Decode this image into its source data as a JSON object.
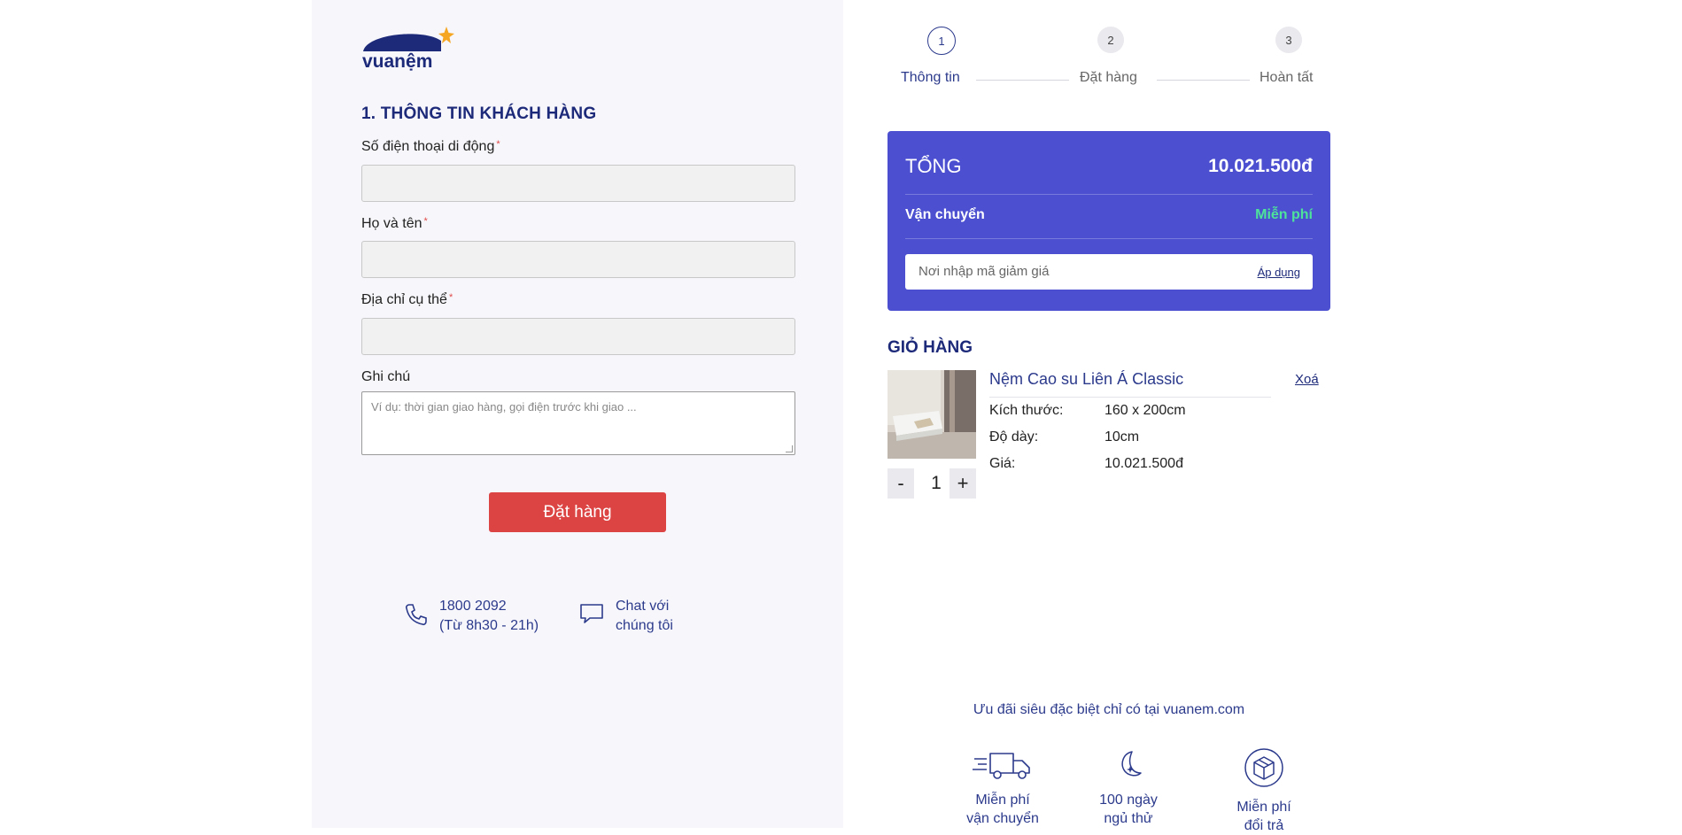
{
  "brand": {
    "logo_text": "vuanệm",
    "accent": "#1d2a7a",
    "star_color": "#f5a623"
  },
  "form": {
    "section_title": "1. THÔNG TIN KHÁCH HÀNG",
    "phone_label": "Số điện thoại di động",
    "name_label": "Họ và tên",
    "address_label": "Địa chỉ cụ thể",
    "note_label": "Ghi chú",
    "required_mark": "*",
    "phone_value": "",
    "name_value": "",
    "address_value": "",
    "note_placeholder": "Ví dụ: thời gian giao hàng, gọi điện trước khi giao ...",
    "submit_label": "Đặt hàng",
    "submit_color": "#dc4444"
  },
  "contact": {
    "phone_line1": "1800 2092",
    "phone_line2": "(Từ 8h30 - 21h)",
    "chat_line1": "Chat với",
    "chat_line2": "chúng tôi",
    "phone_icon": "phone-icon",
    "chat_icon": "chat-bubble-icon"
  },
  "steps": [
    {
      "number": "1",
      "label": "Thông tin",
      "active": true
    },
    {
      "number": "2",
      "label": "Đặt hàng",
      "active": false
    },
    {
      "number": "3",
      "label": "Hoàn tất",
      "active": false
    }
  ],
  "summary": {
    "total_label": "TỔNG",
    "total_value": "10.021.500đ",
    "shipping_label": "Vận chuyển",
    "shipping_value": "Miễn phí",
    "coupon_placeholder": "Nơi nhập mã giảm giá",
    "coupon_apply": "Áp dụng",
    "bg_color": "#4b4fd0",
    "free_color": "#4ee39a"
  },
  "cart": {
    "title": "GIỎ HÀNG",
    "item": {
      "name": "Nệm Cao su Liên Á Classic",
      "remove": "Xoá",
      "size_label": "Kích thước:",
      "size_value": "160 x 200cm",
      "thickness_label": "Độ dày:",
      "thickness_value": "10cm",
      "price_label": "Giá:",
      "price_value": "10.021.500đ",
      "quantity": "1",
      "minus": "-",
      "plus": "+"
    }
  },
  "promo": {
    "title": "Ưu đãi siêu đặc biệt chỉ có tại vuanem.com",
    "perks": [
      {
        "line1": "Miễn phí",
        "line2": "vận chuyển",
        "icon": "delivery-truck-icon"
      },
      {
        "line1": "100 ngày",
        "line2": "ngủ thử",
        "icon": "moon-icon"
      },
      {
        "line1": "Miễn phí",
        "line2": "đổi trả",
        "icon": "return-box-icon"
      }
    ]
  }
}
